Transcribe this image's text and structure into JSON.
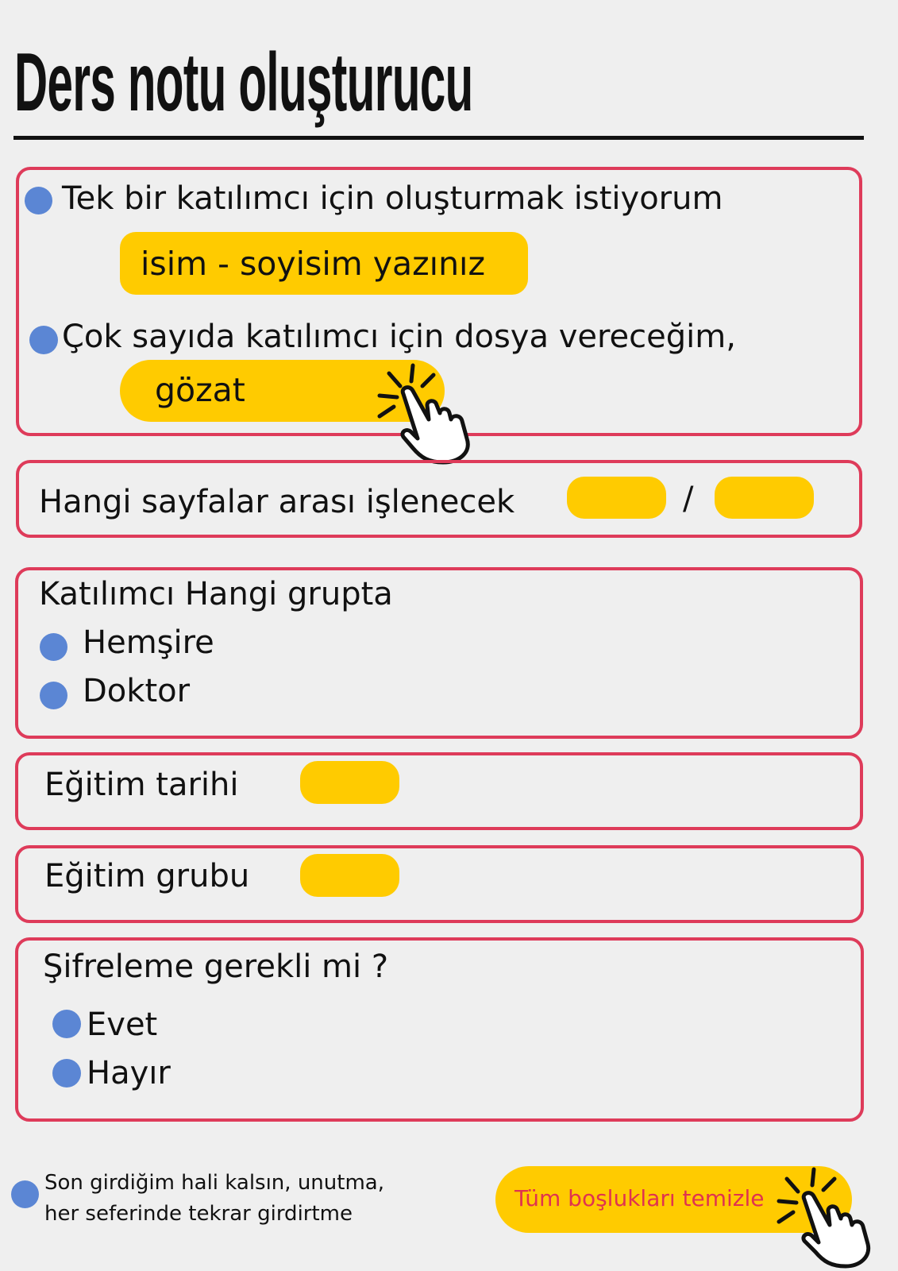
{
  "title": "Ders notu oluşturucu",
  "section_participant": {
    "single_option_label": "Tek bir katılımcı için oluşturmak istiyorum",
    "name_input_placeholder": "isim - soyisim yazınız",
    "multi_option_label": "Çok sayıda katılımcı için dosya vereceğim,",
    "browse_button_label": "gözat"
  },
  "section_pages": {
    "label": "Hangi sayfalar arası işlenecek",
    "separator": "/",
    "from_value": "",
    "to_value": ""
  },
  "section_group": {
    "title": "Katılımcı Hangi grupta",
    "options": [
      "Hemşire",
      "Doktor"
    ]
  },
  "section_date": {
    "label": "Eğitim tarihi",
    "value": ""
  },
  "section_training_group": {
    "label": "Eğitim grubu",
    "value": ""
  },
  "section_encryption": {
    "title": "Şifreleme gerekli mi ?",
    "options": [
      "Evet",
      "Hayır"
    ]
  },
  "footer": {
    "remember_label_line1": "Son girdiğim hali kalsın, unutma,",
    "remember_label_line2": "her seferinde tekrar girdirtme",
    "clear_button_label": "Tüm boşlukları temizle"
  },
  "colors": {
    "accent_red": "#de3b5a",
    "input_yellow": "#ffcb00",
    "radio_blue": "#5b86d4",
    "background": "#efefef"
  },
  "icons": {
    "click_hand": "pointing-hand-click-icon"
  }
}
